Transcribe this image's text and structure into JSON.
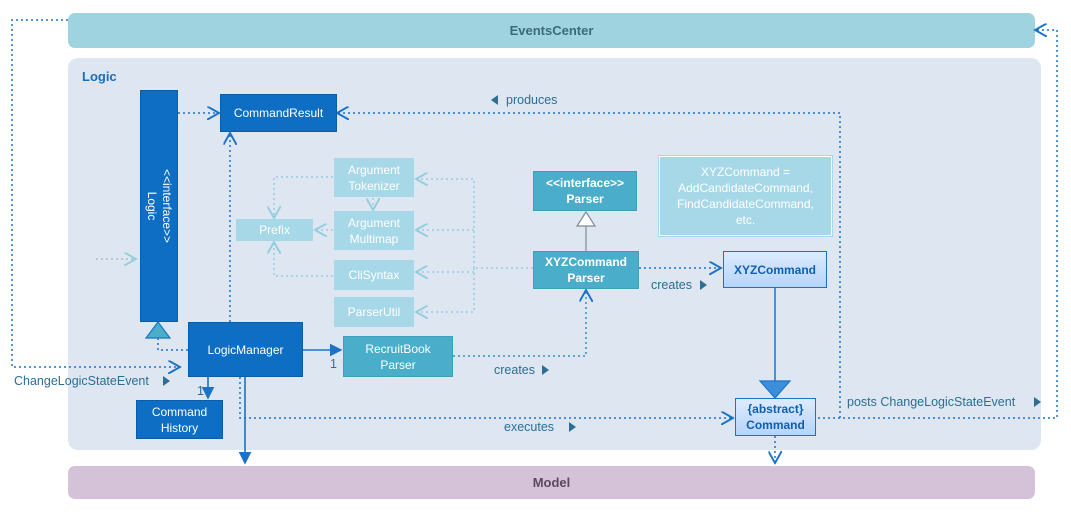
{
  "diagram": {
    "packages": {
      "events_center": "EventsCenter",
      "logic": "Logic",
      "model": "Model"
    },
    "components": {
      "logic_interface_stereotype": "<<interface>>",
      "logic_interface_name": "Logic",
      "command_result": "CommandResult",
      "logic_manager": "LogicManager",
      "command_history_line1": "Command",
      "command_history_line2": "History",
      "recruitbook_parser_line1": "RecruitBook",
      "recruitbook_parser_line2": "Parser",
      "argument_tokenizer_line1": "Argument",
      "argument_tokenizer_line2": "Tokenizer",
      "argument_multimap_line1": "Argument",
      "argument_multimap_line2": "Multimap",
      "cli_syntax": "CliSyntax",
      "parser_util": "ParserUtil",
      "prefix": "Prefix",
      "parser_interface_stereotype": "<<interface>>",
      "parser_interface_name": "Parser",
      "xyz_command_parser_line1": "XYZCommand",
      "xyz_command_parser_line2": "Parser",
      "xyz_command": "XYZCommand",
      "abstract_command_stereotype": "{abstract}",
      "abstract_command_name": "Command"
    },
    "note": {
      "line1": "XYZCommand =",
      "line2": "AddCandidateCommand,",
      "line3": "FindCandidateCommand,",
      "line4": "etc."
    },
    "labels": {
      "produces": "produces",
      "creates_xyz": "creates",
      "creates_parser": "creates",
      "executes": "executes",
      "posts_event": "posts ChangeLogicStateEvent",
      "change_logic_state_event": "ChangeLogicStateEvent",
      "multiplicity_history": "1",
      "multiplicity_parser": "1"
    },
    "colors": {
      "dark_blue": "#0d6ec3",
      "teal": "#4aaecb",
      "light_teal": "#a7d8e8",
      "events_center": "#9fd3e0",
      "model": "#d4c2d9",
      "logic_package": "#dde6f1",
      "connector": "#1a73c9"
    }
  }
}
